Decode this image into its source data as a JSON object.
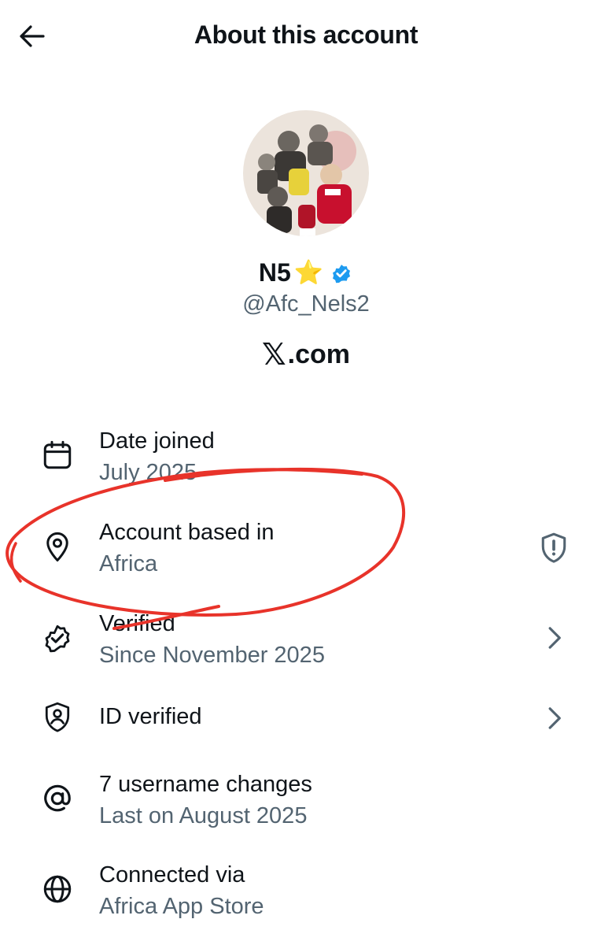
{
  "header": {
    "title": "About this account"
  },
  "profile": {
    "display_name": "N5",
    "name_emoji": "⭐",
    "handle": "@Afc_Nels2",
    "site_logo": "𝕏",
    "site_text": ".com"
  },
  "rows": [
    {
      "label": "Date joined",
      "value": "July 2025",
      "icon": "calendar-icon"
    },
    {
      "label": "Account based in",
      "value": "Africa",
      "icon": "location-pin-icon",
      "action": "shield-alert-icon"
    },
    {
      "label": "Verified",
      "value": "Since November 2025",
      "icon": "verified-badge-icon",
      "action": "chevron-right-icon"
    },
    {
      "label": "ID verified",
      "value": "",
      "icon": "id-shield-icon",
      "action": "chevron-right-icon"
    },
    {
      "label": "7 username changes",
      "value": "Last on August 2025",
      "icon": "at-sign-icon"
    },
    {
      "label": "Connected via",
      "value": "Africa App Store",
      "icon": "globe-icon"
    }
  ],
  "colors": {
    "text": "#0f1419",
    "secondary": "#536471",
    "verified_blue": "#1d9bf0",
    "annotation_red": "#e8332a"
  }
}
